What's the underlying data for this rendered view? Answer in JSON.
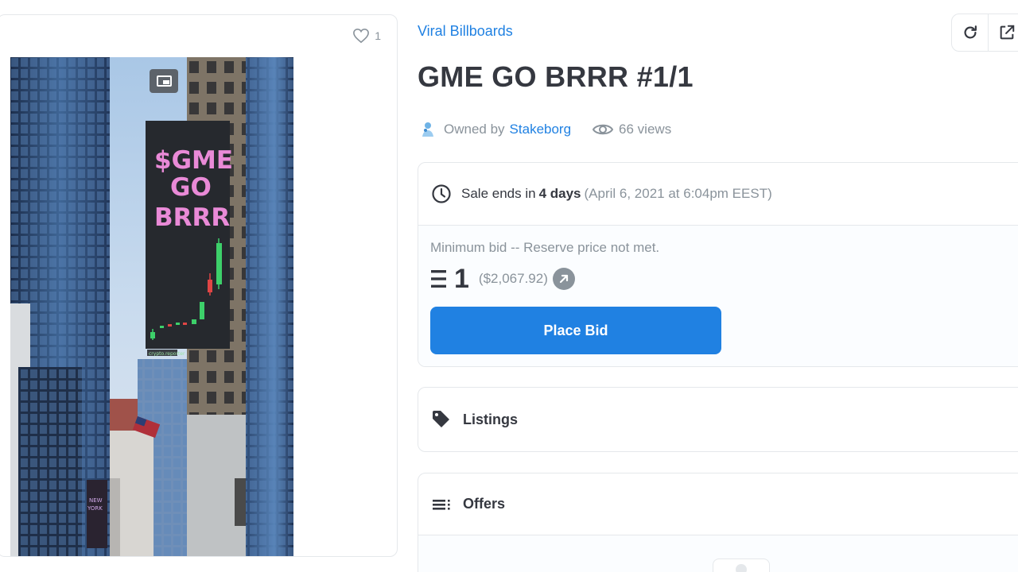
{
  "media": {
    "favorite_count": "1",
    "billboard_text": [
      "$GME",
      "GO",
      "BRRR"
    ],
    "billboard_footer": "crypto.reporter"
  },
  "header": {
    "collection": "Viral Billboards",
    "title": "GME GO BRRR #1/1",
    "owned_by_label": "Owned by",
    "owner": "Stakeborg",
    "views": "66 views"
  },
  "toolbar": {
    "refresh_icon": "refresh-icon",
    "share_icon": "external-link-icon"
  },
  "sale": {
    "ends_label": "Sale ends in",
    "ends_in": "4 days",
    "ends_date": "(April 6, 2021 at 6:04pm EEST)",
    "min_bid_label": "Minimum bid -- Reserve price not met.",
    "price": "1",
    "price_usd": "($2,067.92)",
    "place_bid_label": "Place Bid"
  },
  "listings": {
    "label": "Listings"
  },
  "offers": {
    "label": "Offers"
  },
  "colors": {
    "accent": "#2081e2",
    "text": "#353840",
    "muted": "#8a939b",
    "border": "#e5e8eb"
  }
}
